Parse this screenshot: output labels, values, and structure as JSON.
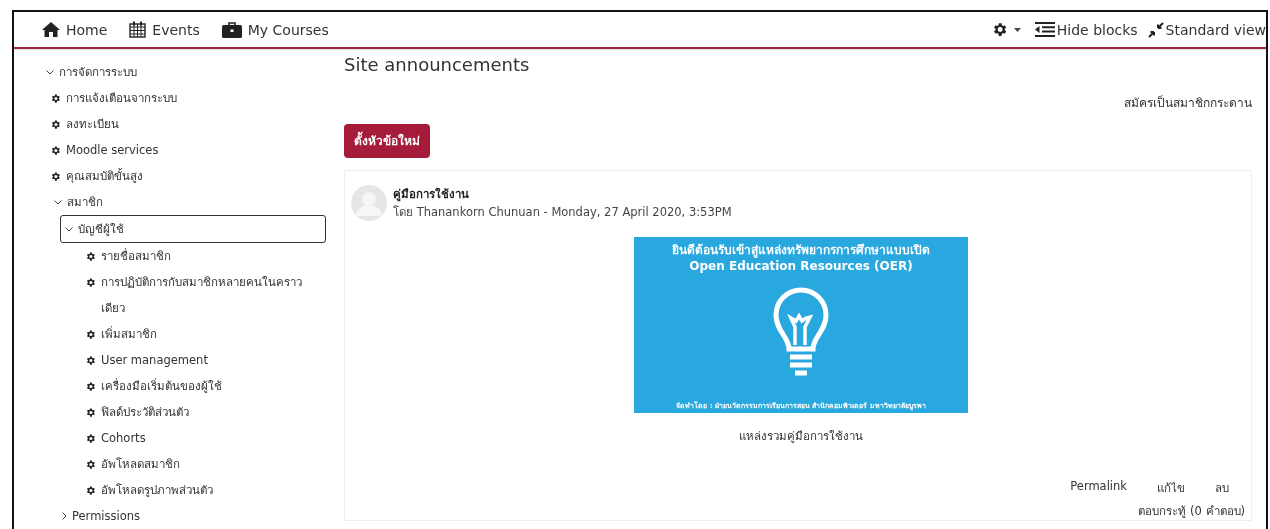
{
  "navbar": {
    "left": [
      {
        "kind": "home",
        "label": "Home"
      },
      {
        "kind": "calendar",
        "label": "Events"
      },
      {
        "kind": "briefcase",
        "label": "My Courses"
      }
    ],
    "right": [
      {
        "kind": "settings"
      },
      {
        "kind": "blocks",
        "label": "Hide blocks"
      },
      {
        "kind": "view",
        "label": "Standard view"
      }
    ]
  },
  "sidebar": {
    "tree": [
      {
        "label": "การจัดการระบบ",
        "kind": "branch",
        "expanded": true,
        "selected": false,
        "children": [
          {
            "label": "การแจ้งเตือนจากระบบ",
            "kind": "leaf",
            "selected": false
          },
          {
            "label": "ลงทะเบียน",
            "kind": "leaf",
            "selected": false
          },
          {
            "label": "Moodle services",
            "kind": "leaf",
            "selected": false
          },
          {
            "label": "คุณสมบัติขั้นสูง",
            "kind": "leaf",
            "selected": false
          },
          {
            "label": "สมาชิก",
            "kind": "branch",
            "expanded": true,
            "selected": false,
            "children": [
              {
                "label": "บัญชีผู้ใช้",
                "kind": "branch",
                "expanded": true,
                "selected": true,
                "children": [
                  {
                    "label": "รายชื่อสมาชิก",
                    "kind": "leaf",
                    "selected": false
                  },
                  {
                    "label": "การปฏิบัติการกับสมาชิกหลายคนในคราวเดียว",
                    "kind": "leaf",
                    "selected": false
                  },
                  {
                    "label": "เพิ่มสมาชิก",
                    "kind": "leaf",
                    "selected": false
                  },
                  {
                    "label": "User management",
                    "kind": "leaf",
                    "selected": false
                  },
                  {
                    "label": "เครื่องมือเริ่มต้นของผู้ใช้",
                    "kind": "leaf",
                    "selected": false
                  },
                  {
                    "label": "ฟิลด์ประวัติส่วนตัว",
                    "kind": "leaf",
                    "selected": false
                  },
                  {
                    "label": "Cohorts",
                    "kind": "leaf",
                    "selected": false
                  },
                  {
                    "label": "อัพโหลดสมาชิก",
                    "kind": "leaf",
                    "selected": false
                  },
                  {
                    "label": "อัพโหลดรูปภาพส่วนตัว",
                    "kind": "leaf",
                    "selected": false
                  }
                ]
              },
              {
                "label": "Permissions",
                "kind": "branch",
                "expanded": false,
                "selected": false
              }
            ]
          }
        ]
      }
    ]
  },
  "main": {
    "title": "Site announcements",
    "subscribe_link": "สมัครเป็นสมาชิกกระดาน",
    "new_topic_button": "ตั้งหัวข้อใหม่",
    "post": {
      "subject": "คู่มือการใช้งาน",
      "byline": "โดย Thanankorn Chunuan - Monday, 27 April 2020, 3:53PM",
      "banner": {
        "heading": "ยินดีต้อนรับเข้าสู่แหล่งทรัพยากรการศึกษาแบบเปิด",
        "subheading": "Open Education Resources (OER)",
        "credit": "จัดทำโดย : ฝ่ายนวัตกรรมการเรียนการสอน สำนักคอมพิวเตอร์ มหาวิทยาลัยบูรพา"
      },
      "caption": "แหล่งรวมคู่มือการใช้งาน",
      "actions": [
        "Permalink",
        "แก้ไข",
        "ลบ"
      ],
      "reply_link": "ตอบกระทู้ (0 คำตอบ)"
    }
  }
}
